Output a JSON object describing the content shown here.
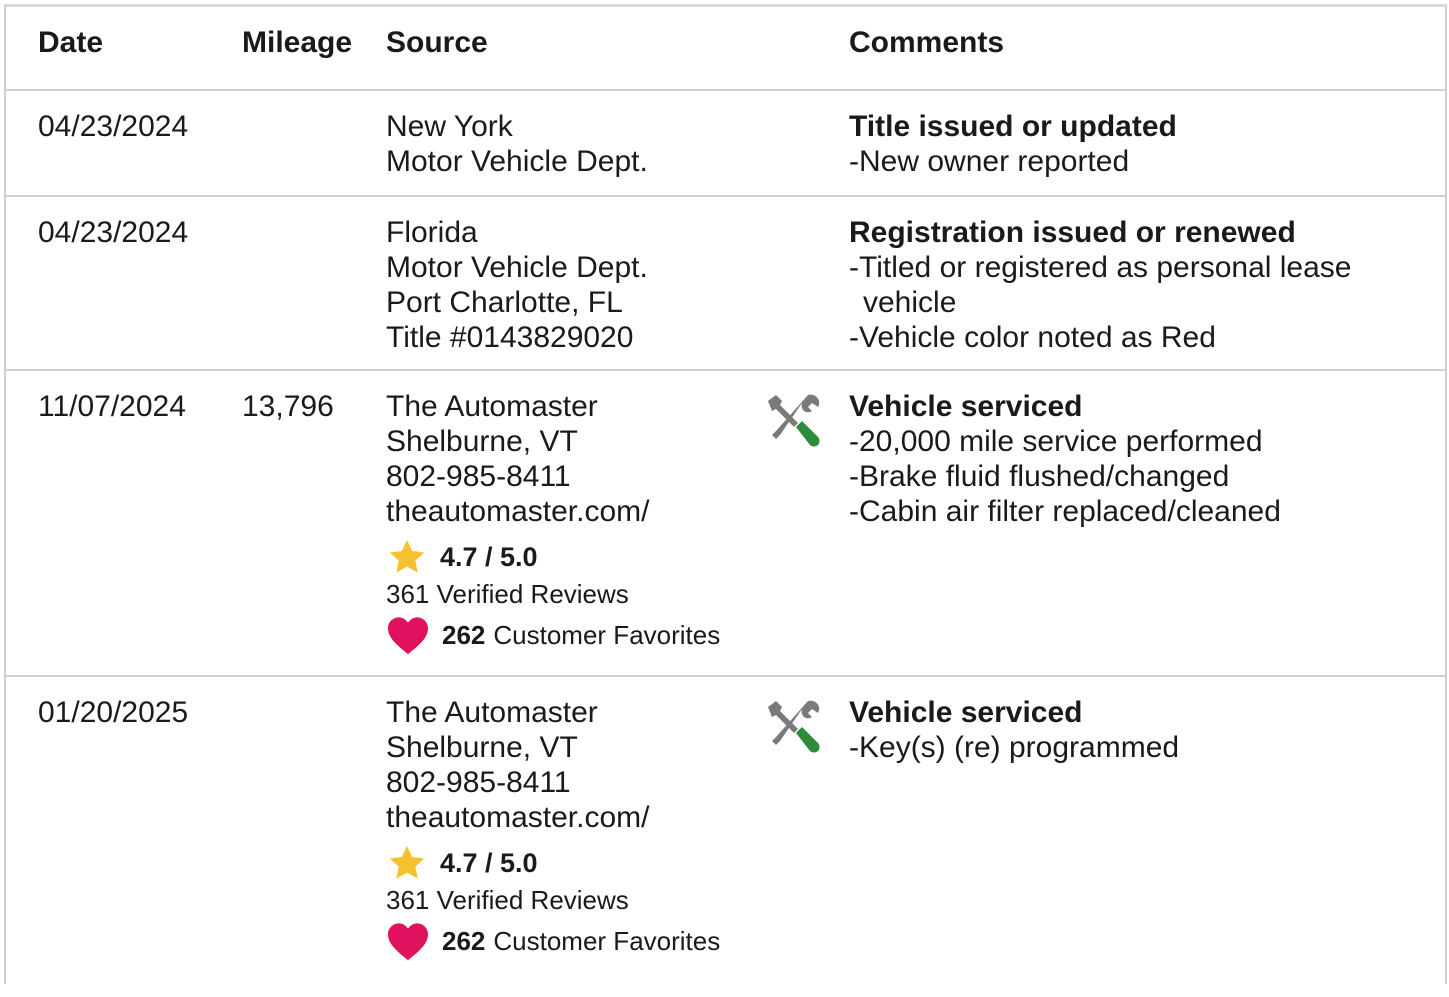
{
  "header": {
    "date": "Date",
    "mileage": "Mileage",
    "source": "Source",
    "comments": "Comments"
  },
  "records": [
    {
      "date": "04/23/2024",
      "mileage": "",
      "source": [
        "New York",
        "Motor Vehicle Dept."
      ],
      "comment_title": "Title issued or updated",
      "comment_items": [
        "New owner reported"
      ]
    },
    {
      "date": "04/23/2024",
      "mileage": "",
      "source": [
        "Florida",
        "Motor Vehicle Dept.",
        "Port Charlotte, FL",
        "Title #0143829020"
      ],
      "comment_title": "Registration issued or renewed",
      "comment_items": [
        "Titled or registered as personal lease vehicle",
        "Vehicle color noted as Red"
      ]
    },
    {
      "date": "11/07/2024",
      "mileage": "13,796",
      "source": [
        "The Automaster",
        "Shelburne, VT",
        "802-985-8411",
        "theautomaster.com/"
      ],
      "rating": "4.7 / 5.0",
      "reviews": "361 Verified Reviews",
      "favorites_count": "262",
      "favorites_label": "Customer Favorites",
      "comment_title": "Vehicle serviced",
      "comment_items": [
        "20,000 mile service performed",
        "Brake fluid flushed/changed",
        "Cabin air filter replaced/cleaned"
      ]
    },
    {
      "date": "01/20/2025",
      "mileage": "",
      "source": [
        "The Automaster",
        "Shelburne, VT",
        "802-985-8411",
        "theautomaster.com/"
      ],
      "rating": "4.7 / 5.0",
      "reviews": "361 Verified Reviews",
      "favorites_count": "262",
      "favorites_label": "Customer Favorites",
      "comment_title": "Vehicle serviced",
      "comment_items": [
        "Key(s) (re) programmed"
      ]
    }
  ],
  "icons": {
    "rating": "star-icon",
    "favorites": "heart-icon",
    "service": "wrench-screwdriver-icon"
  },
  "colors": {
    "star": "#f5c12e",
    "heart": "#e0115f",
    "tool_gray": "#7a7a7a",
    "tool_green": "#2e8b3a"
  }
}
